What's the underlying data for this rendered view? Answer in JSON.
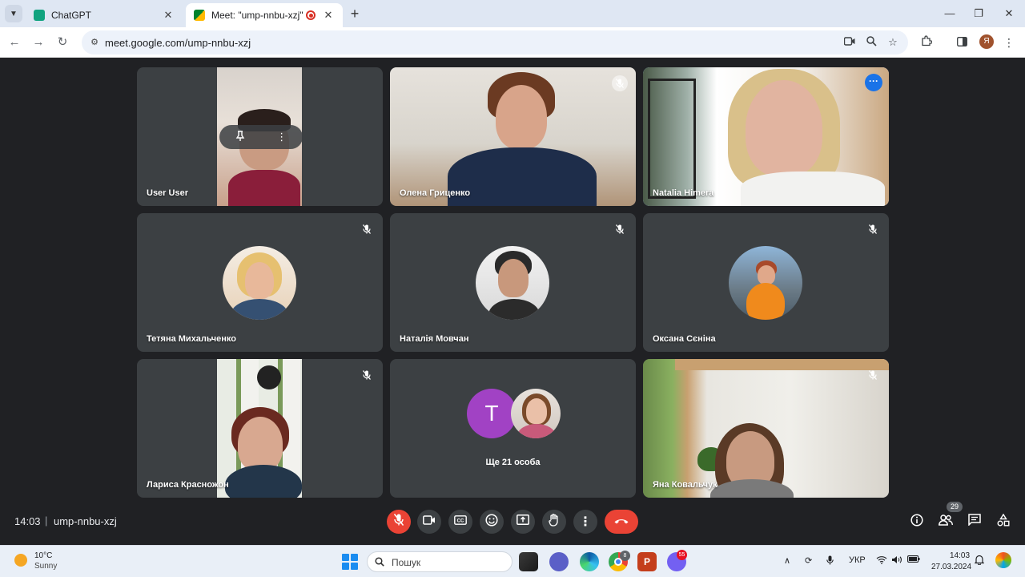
{
  "browser": {
    "tabs": [
      {
        "title": "ChatGPT",
        "favicon": "chatgpt-icon",
        "active": false
      },
      {
        "title": "Meet: \"ump-nnbu-xzj\"",
        "favicon": "google-meet-icon",
        "active": true,
        "recording": true
      }
    ],
    "url": "meet.google.com/ump-nnbu-xzj",
    "profile_initial": "Я"
  },
  "meet": {
    "participants": [
      {
        "name": "User User",
        "type": "video",
        "muted": false,
        "pinned_overlay": true
      },
      {
        "name": "Олена Гриценко",
        "type": "video",
        "muted": true
      },
      {
        "name": "Natalia Himera",
        "type": "video",
        "muted": false,
        "active_speaker": true
      },
      {
        "name": "Тетяна Михальченко",
        "type": "avatar",
        "muted": true
      },
      {
        "name": "Наталія Мовчан",
        "type": "avatar",
        "muted": true
      },
      {
        "name": "Оксана Сєніна",
        "type": "avatar",
        "muted": true
      },
      {
        "name": "Лариса Красножон",
        "type": "video",
        "muted": true
      },
      {
        "name": "Ще 21 особа",
        "type": "others",
        "initial": "T"
      },
      {
        "name": "Яна Ковальчук",
        "type": "video",
        "muted": true
      }
    ],
    "time": "14:03",
    "separator": "|",
    "meeting_code": "ump-nnbu-xzj",
    "participant_count": "29",
    "colors": {
      "red": "#ea4335",
      "tile": "#3c4043",
      "background": "#202124",
      "accent": "#1a73e8",
      "avatar_purple": "#a142c4"
    }
  },
  "taskbar": {
    "temperature": "10°C",
    "condition": "Sunny",
    "search_placeholder": "Пошук",
    "language": "УКР",
    "time": "14:03",
    "date": "27.03.2024",
    "chrome_badge": "8",
    "viber_badge": "55"
  }
}
